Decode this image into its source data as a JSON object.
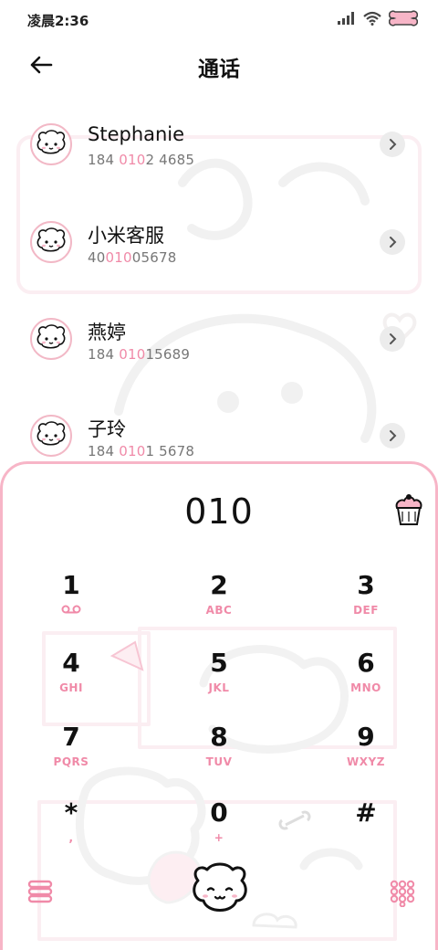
{
  "status_bar": {
    "time": "凌晨2:36",
    "icons": [
      "signal-icon",
      "wifi-icon",
      "bone-battery-icon"
    ]
  },
  "header": {
    "title": "通话",
    "back_icon": "back-arrow-icon"
  },
  "contacts": [
    {
      "name": "Stephanie",
      "number_pre": "184 ",
      "number_hl": "010",
      "number_post": "2 4685"
    },
    {
      "name": "小米客服",
      "number_pre": "40",
      "number_hl": "010",
      "number_post": "05678"
    },
    {
      "name": "燕婷",
      "number_pre": "184 ",
      "number_hl": "010",
      "number_post": "15689"
    },
    {
      "name": "子玲",
      "number_pre": "184 ",
      "number_hl": "010",
      "number_post": "1 5678"
    }
  ],
  "dialer": {
    "input": "010",
    "keys": [
      {
        "digit": "1",
        "letters": ""
      },
      {
        "digit": "2",
        "letters": "ABC"
      },
      {
        "digit": "3",
        "letters": "DEF"
      },
      {
        "digit": "4",
        "letters": "GHI"
      },
      {
        "digit": "5",
        "letters": "JKL"
      },
      {
        "digit": "6",
        "letters": "MNO"
      },
      {
        "digit": "7",
        "letters": "PQRS"
      },
      {
        "digit": "8",
        "letters": "TUV"
      },
      {
        "digit": "9",
        "letters": "WXYZ"
      },
      {
        "digit": "*",
        "letters": ","
      },
      {
        "digit": "0",
        "letters": "+"
      },
      {
        "digit": "#",
        "letters": ""
      }
    ]
  },
  "colors": {
    "accent": "#f08aa8",
    "border": "#f7b5c7",
    "text": "#111111",
    "secondary_text": "#777777"
  }
}
